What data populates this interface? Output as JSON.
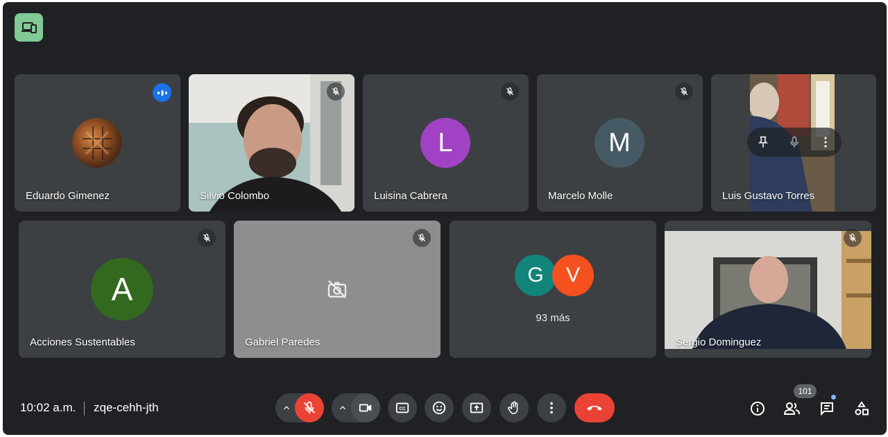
{
  "participants": [
    {
      "name": "Eduardo Gimenez",
      "state": "speaking"
    },
    {
      "name": "Silvio Colombo",
      "state": "muted"
    },
    {
      "name": "Luisina Cabrera",
      "initial": "L",
      "avatar_color": "#a142c4",
      "state": "muted"
    },
    {
      "name": "Marcelo Molle",
      "initial": "M",
      "avatar_color": "#455a64",
      "state": "muted"
    },
    {
      "name": "Luis Gustavo Torres",
      "state": "hover"
    },
    {
      "name": "Acciones Sustentables",
      "initial": "A",
      "avatar_color": "#33691e",
      "state": "muted"
    },
    {
      "name": "Gabriel Paredes",
      "state": "muted",
      "camera": "off"
    },
    {
      "name": "Sergio Dominguez",
      "state": "muted"
    }
  ],
  "overflow": {
    "initials": [
      "G",
      "V"
    ],
    "colors": [
      "#12847a",
      "#f4511e"
    ],
    "label": "93 más"
  },
  "meeting": {
    "time": "10:02 a.m.",
    "code": "zqe-cehh-jth"
  },
  "people_count": "101",
  "icons": [
    "screen-share-present-icon",
    "speaking-indicator-icon",
    "mic-off-icon",
    "pin-icon",
    "more-vert-icon",
    "camera-off-icon",
    "chevron-up-icon",
    "video-camera-icon",
    "closed-caption-icon",
    "emoji-icon",
    "present-screen-icon",
    "raise-hand-icon",
    "end-call-icon",
    "info-icon",
    "people-icon",
    "chat-icon",
    "activities-icon"
  ],
  "colors": {
    "background": "#202124",
    "tile": "#3c4043",
    "end_call": "#ea4335",
    "speaking": "#1a73e8"
  }
}
